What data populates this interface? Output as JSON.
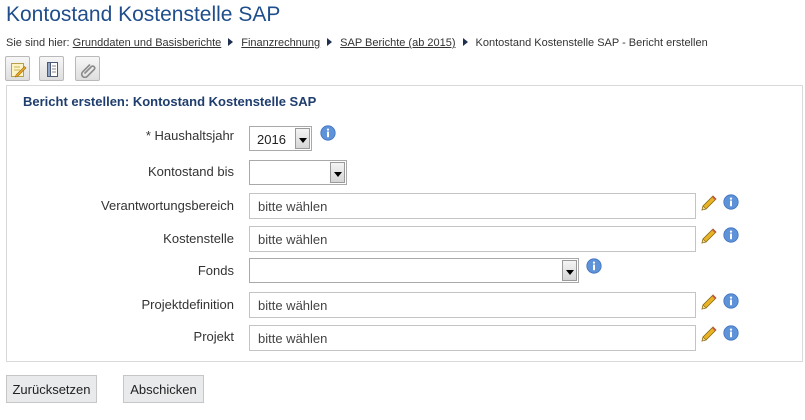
{
  "page": {
    "title": "Kontostand Kostenstelle SAP"
  },
  "breadcrumb": {
    "prefix": "Sie sind hier:",
    "items": [
      "Grunddaten und Basisberichte",
      "Finanzrechnung",
      "SAP Berichte (ab 2015)"
    ],
    "current": "Kontostand Kostenstelle SAP - Bericht erstellen"
  },
  "toolbar": {
    "icons": [
      "edit-icon",
      "document-icon",
      "attachment-icon"
    ]
  },
  "form": {
    "heading": "Bericht erstellen: Kontostand Kostenstelle SAP",
    "fields": {
      "haushaltsjahr": {
        "label": "* Haushaltsjahr",
        "value": "2016"
      },
      "kontostand_bis": {
        "label": "Kontostand bis",
        "value": ""
      },
      "verantwortungsbereich": {
        "label": "Verantwortungsbereich",
        "placeholder": "bitte wählen"
      },
      "kostenstelle": {
        "label": "Kostenstelle",
        "placeholder": "bitte wählen"
      },
      "fonds": {
        "label": "Fonds",
        "value": ""
      },
      "projektdefinition": {
        "label": "Projektdefinition",
        "placeholder": "bitte wählen"
      },
      "projekt": {
        "label": "Projekt",
        "placeholder": "bitte wählen"
      }
    }
  },
  "buttons": {
    "reset": "Zurücksetzen",
    "submit": "Abschicken"
  },
  "colors": {
    "title": "#1f4e8c",
    "heading": "#1f3d6d",
    "info": "#5f93d9",
    "pencil": "#e8b325"
  }
}
